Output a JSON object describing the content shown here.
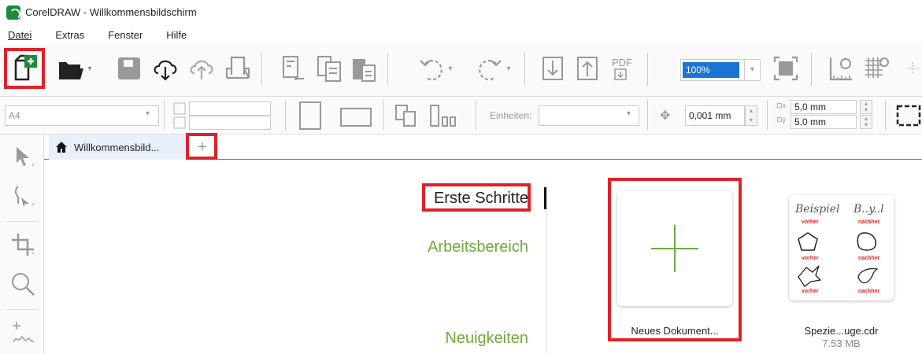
{
  "window": {
    "title": "CorelDRAW - Willkommensbildschirm"
  },
  "menu": [
    "Datei",
    "Extras",
    "Fenster",
    "Hilfe"
  ],
  "toolbar": {
    "zoom_value": "100%",
    "icons": [
      "new-document-icon",
      "open-icon",
      "save-icon",
      "download-cloud-icon",
      "upload-cloud-icon",
      "print-icon",
      "import-icon",
      "export-icon",
      "paste-icon",
      "undo-icon",
      "redo-icon",
      "pdf-icon",
      "fullscreen-icon",
      "rulers-icon",
      "grid-icon"
    ]
  },
  "propbar": {
    "page_size": "A4",
    "units_label": "Einheiten:",
    "nudge_value": "0,001 mm",
    "dup_x": "5,0 mm",
    "dup_y": "5,0 mm"
  },
  "tabs": {
    "home_label": "Willkommensbild...",
    "add_label": "+"
  },
  "welcome": {
    "nav": [
      "Erste Schritte",
      "Arbeitsbereich",
      "Neuigkeiten"
    ],
    "active_nav": "Erste Schritte",
    "cards": [
      {
        "label": "Neues Dokument...",
        "sub": ""
      },
      {
        "label": "Spezie...uge.cdr",
        "sub": "7.53 MB"
      }
    ],
    "thumb_texts": {
      "t1": "Beispiel",
      "t2": "B..y..l",
      "vorher": "vorher",
      "nachher": "nachher"
    }
  },
  "colors": {
    "accent_green": "#6fa83c",
    "highlight_red": "#e0202a",
    "tab_blue": "#2b87d6"
  }
}
